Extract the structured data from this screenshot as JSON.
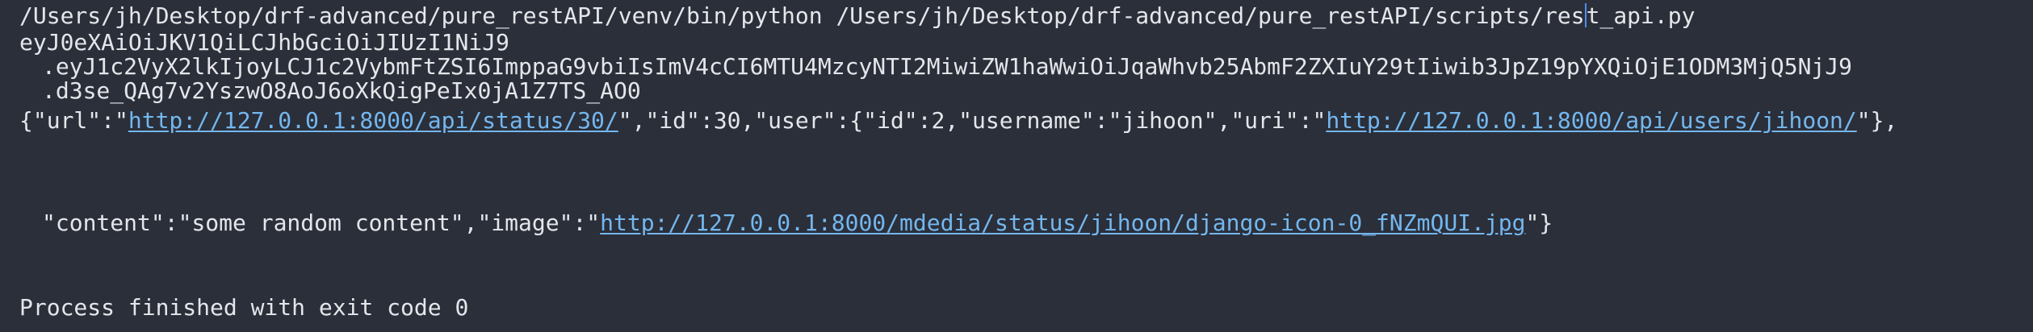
{
  "console": {
    "command": {
      "before_caret": "/Users/jh/Desktop/drf-advanced/pure_restAPI/venv/bin/python /Users/jh/Desktop/drf-advanced/pure_restAPI/scripts/res",
      "after_caret": "t_api.py"
    },
    "token": {
      "part1": "eyJ0eXAiOiJKV1QiLCJhbGciOiJIUzI1NiJ9",
      "part2": ".eyJ1c2VyX2lkIjoyLCJ1c2VybmFtZSI6ImppaG9vbiIsImV4cCI6MTU4MzcyNTI2MiwiZW1haWwiOiJqaWhvb25AbmF2ZXIuY29tIiwib3JpZ19pYXQiOjE1ODM3MjQ5NjJ9",
      "part3": ".d3se_QAg7v2YszwO8AoJ6oXkQigPeIx0jA1Z7TS_AO0"
    },
    "json_line1": {
      "t1": "{\"url\":\"",
      "url_link": "http://127.0.0.1:8000/api/status/30/",
      "t2": "\",\"id\":30,\"user\":{\"id\":2,\"username\":\"jihoon\",\"uri\":\"",
      "uri_link": "http://127.0.0.1:8000/api/users/jihoon/",
      "t3": "\"},"
    },
    "json_line2": {
      "t1": "\"content\":\"some random content\",\"image\":\"",
      "image_link": "http://127.0.0.1:8000/mdedia/status/jihoon/django-icon-0_fNZmQUI.jpg",
      "t2": "\"}"
    },
    "exit_message": "Process finished with exit code 0"
  }
}
